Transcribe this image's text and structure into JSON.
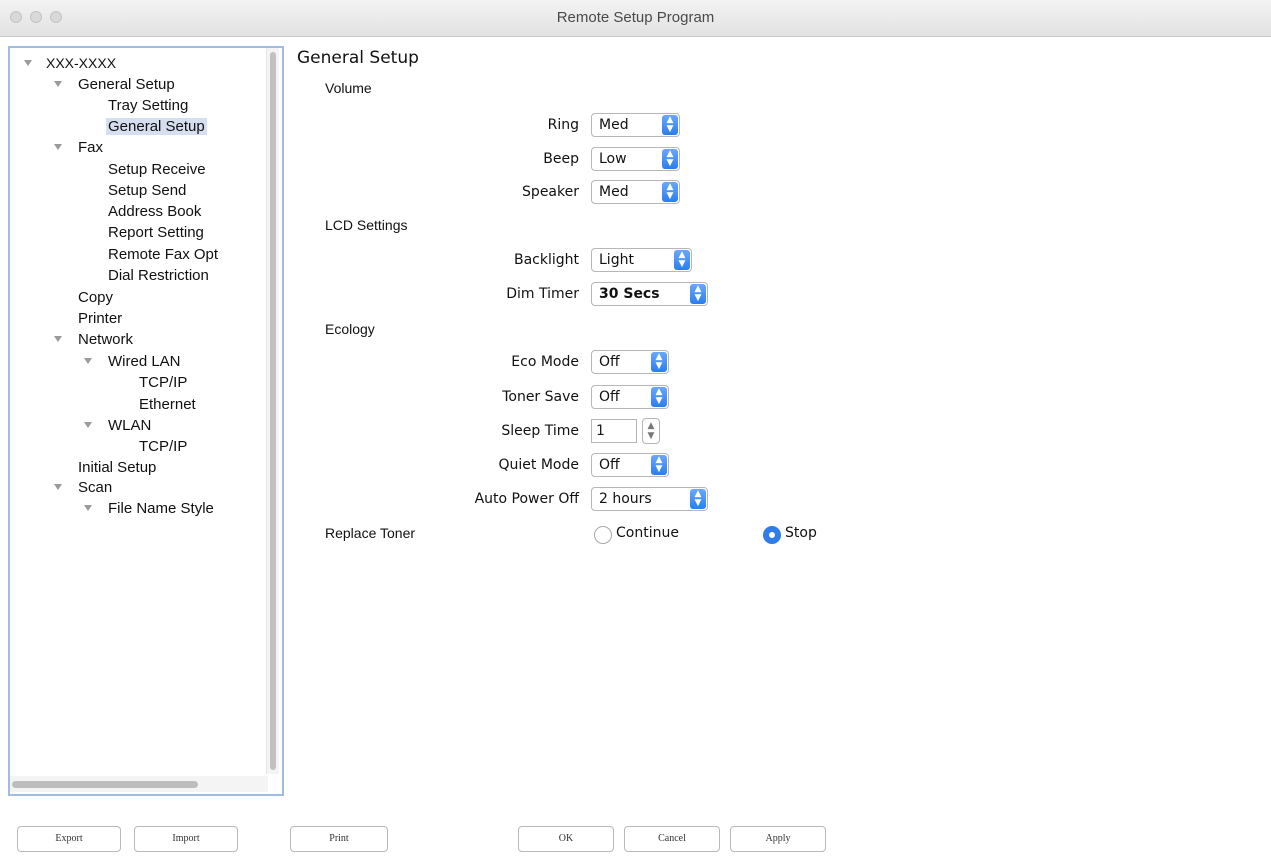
{
  "window": {
    "title": "Remote Setup Program"
  },
  "tree": {
    "items": [
      {
        "label": "XXX-XXXX"
      },
      {
        "label": "General Setup"
      },
      {
        "label": "Tray Setting"
      },
      {
        "label": "General Setup"
      },
      {
        "label": "Fax"
      },
      {
        "label": "Setup Receive"
      },
      {
        "label": "Setup Send"
      },
      {
        "label": "Address Book"
      },
      {
        "label": "Report Setting"
      },
      {
        "label": "Remote Fax Opt"
      },
      {
        "label": "Dial Restriction"
      },
      {
        "label": "Copy"
      },
      {
        "label": "Printer"
      },
      {
        "label": "Network"
      },
      {
        "label": "Wired LAN"
      },
      {
        "label": "TCP/IP"
      },
      {
        "label": "Ethernet"
      },
      {
        "label": "WLAN"
      },
      {
        "label": "TCP/IP"
      },
      {
        "label": "Initial Setup"
      },
      {
        "label": "Scan"
      },
      {
        "label": "File Name Style"
      }
    ],
    "selected_label": "General Setup"
  },
  "main": {
    "title": "General Setup",
    "volume": {
      "heading": "Volume",
      "ring": {
        "label": "Ring",
        "value": "Med"
      },
      "beep": {
        "label": "Beep",
        "value": "Low"
      },
      "speaker": {
        "label": "Speaker",
        "value": "Med"
      }
    },
    "lcd": {
      "heading": "LCD Settings",
      "backlight": {
        "label": "Backlight",
        "value": "Light"
      },
      "dim_timer": {
        "label": "Dim Timer",
        "value": "30 Secs"
      }
    },
    "ecology": {
      "heading": "Ecology",
      "eco_mode": {
        "label": "Eco Mode",
        "value": "Off"
      },
      "toner_save": {
        "label": "Toner Save",
        "value": "Off"
      },
      "sleep_time": {
        "label": "Sleep Time",
        "value": "1"
      },
      "quiet_mode": {
        "label": "Quiet Mode",
        "value": "Off"
      },
      "auto_power_off": {
        "label": "Auto Power Off",
        "value": "2 hours"
      }
    },
    "replace_toner": {
      "heading": "Replace Toner",
      "continue_label": "Continue",
      "stop_label": "Stop",
      "selected": "Stop"
    }
  },
  "footer": {
    "export": "Export",
    "import": "Import",
    "print": "Print",
    "ok": "OK",
    "cancel": "Cancel",
    "apply": "Apply"
  },
  "colors": {
    "accent": "#2f7de8",
    "selection": "#d5dff0",
    "panel_border": "#9fbde2"
  }
}
